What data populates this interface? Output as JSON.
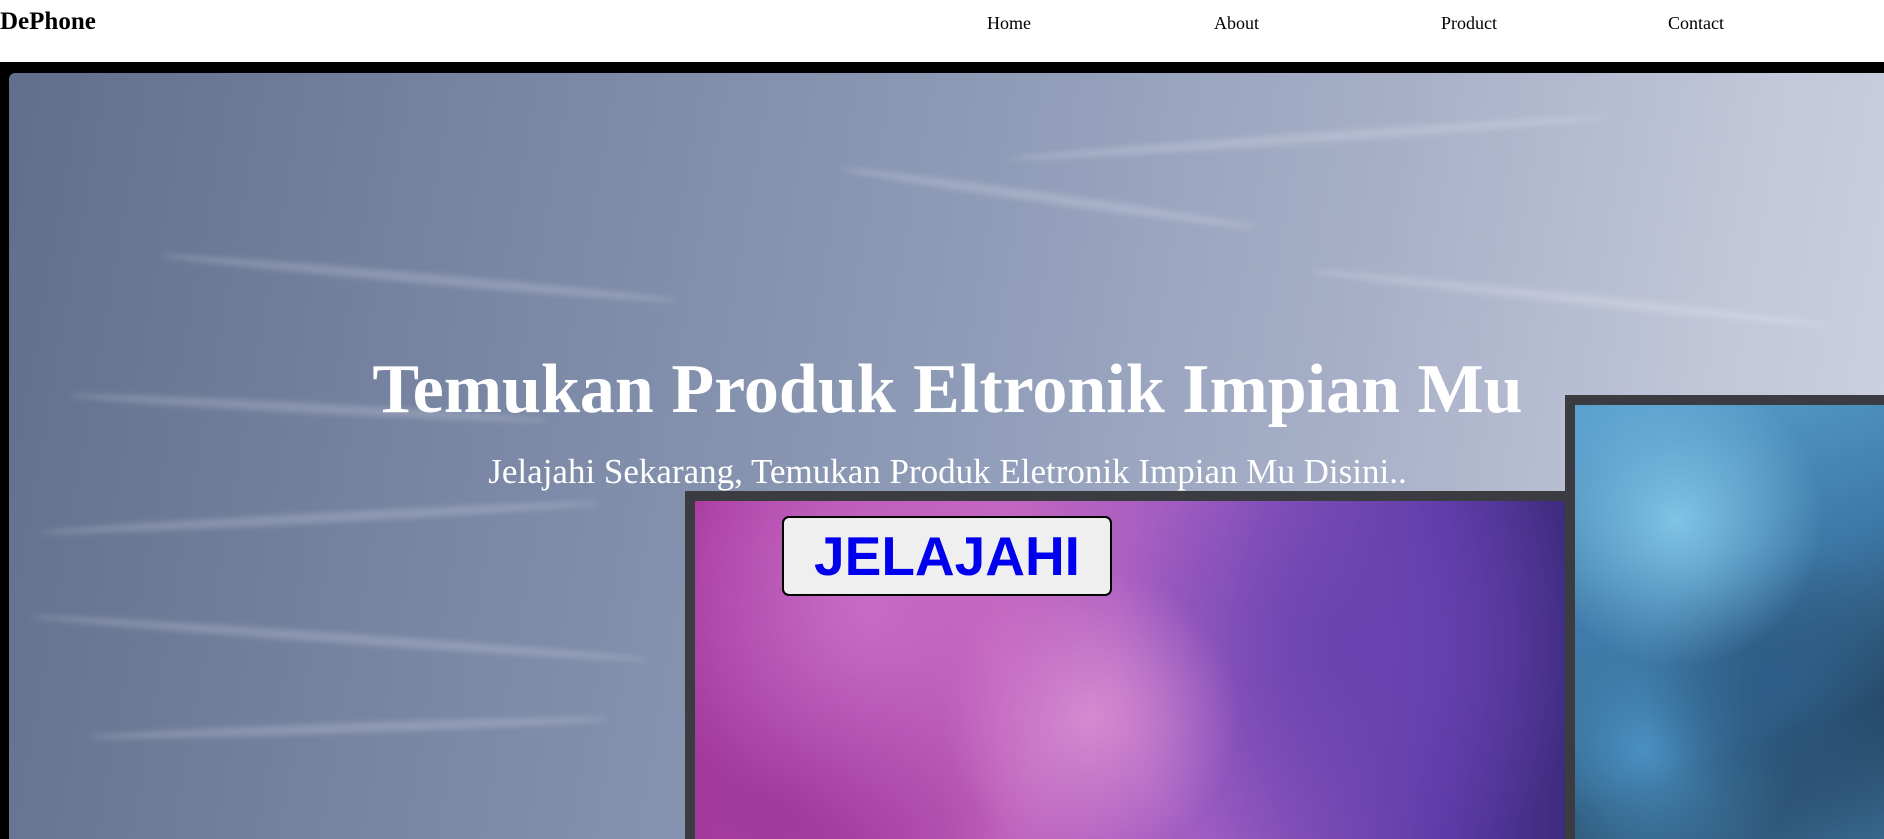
{
  "navbar": {
    "brand": "DePhone",
    "links": [
      {
        "label": "Home"
      },
      {
        "label": "About"
      },
      {
        "label": "Product"
      },
      {
        "label": "Contact"
      }
    ]
  },
  "hero": {
    "title": "Temukan Produk Eltronik Impian Mu",
    "subtitle": "Jelajahi Sekarang, Temukan Produk Eletronik Impian Mu Disini..",
    "cta_label": "JELAJAHI"
  },
  "colors": {
    "nav_background": "#ffffff",
    "frame": "#000000",
    "hero_text": "#ffffff",
    "cta_text": "#0000ee",
    "cta_background": "#efefef"
  }
}
